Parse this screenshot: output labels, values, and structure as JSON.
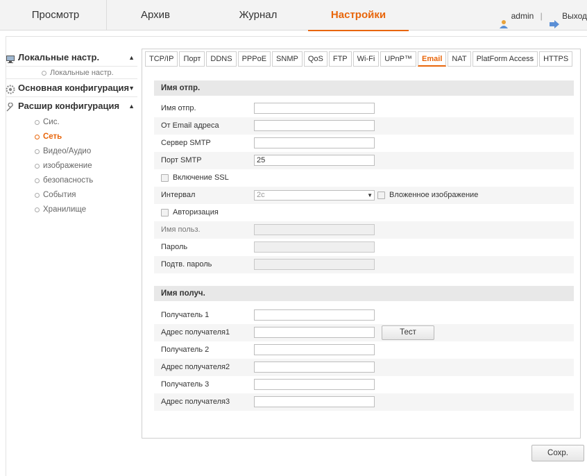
{
  "topnav": {
    "tabs": [
      {
        "label": "Просмотр"
      },
      {
        "label": "Архив"
      },
      {
        "label": "Журнал"
      },
      {
        "label": "Настройки"
      }
    ],
    "user": "admin",
    "separator": "|",
    "logout": "Выход",
    "active_color": "#e8650a"
  },
  "sidebar": {
    "group1": {
      "label": "Локальные настр.",
      "icon": "computer-icon",
      "items": [
        "Локальные настр."
      ]
    },
    "group2": {
      "label": "Основная конфигурация",
      "icon": "gear-icon"
    },
    "group3": {
      "label": "Расшир конфигурация",
      "icon": "wrench-icon",
      "items": [
        "Сис.",
        "Сеть",
        "Видео/Аудио",
        "изображение",
        "безопасность",
        "События",
        "Хранилище"
      ],
      "active": "Сеть"
    }
  },
  "tabs": [
    "TCP/IP",
    "Порт",
    "DDNS",
    "PPPoE",
    "SNMP",
    "QoS",
    "FTP",
    "Wi-Fi",
    "UPnP™",
    "Email",
    "NAT",
    "PlatForm Access",
    "HTTPS"
  ],
  "active_tab": "Email",
  "sender": {
    "section": "Имя отпр.",
    "name_label": "Имя отпр.",
    "name_value": "",
    "email_label": "От Email адреса",
    "email_value": "",
    "smtp_label": "Сервер SMTP",
    "smtp_value": "",
    "port_label": "Порт SMTP",
    "port_value": "25",
    "ssl_label": "Включение SSL",
    "interval_label": "Интервал",
    "interval_value": "2с",
    "attach_label": "Вложенное изображение",
    "auth_label": "Авторизация",
    "user_label": "Имя польз.",
    "pass_label": "Пароль",
    "confirm_label": "Подтв. пароль"
  },
  "receiver": {
    "section": "Имя получ.",
    "r1_label": "Получатель 1",
    "a1_label": "Адрес получателя1",
    "r2_label": "Получатель 2",
    "a2_label": "Адрес получателя2",
    "r3_label": "Получатель 3",
    "a3_label": "Адрес получателя3",
    "test_label": "Тест"
  },
  "save_label": "Сохр."
}
